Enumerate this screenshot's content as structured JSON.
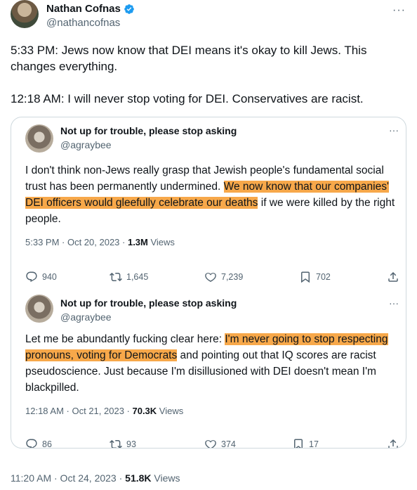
{
  "author": {
    "name": "Nathan Cofnas",
    "handle": "@nathancofnas"
  },
  "main_text": "5:33 PM: Jews now know that DEI means it's okay to kill Jews. This changes everything.\n\n12:18 AM: I will never stop voting for DEI. Conservatives are racist.",
  "quotes": [
    {
      "name": "Not up for trouble, please stop asking",
      "handle": "@agraybee",
      "text_before": "I don't think non-Jews really grasp that Jewish people's fundamental social trust has been permanently undermined. ",
      "text_highlight": "We now know that our companies' DEI officers would gleefully celebrate our deaths",
      "text_after": " if we were killed by the right people.",
      "time": "5:33 PM · Oct 20, 2023 · ",
      "views_count": "1.3M",
      "views_label": " Views",
      "replies": "940",
      "reposts": "1,645",
      "likes": "7,239",
      "bookmarks": "702"
    },
    {
      "name": "Not up for trouble, please stop asking",
      "handle": "@agraybee",
      "text_before": "Let me be abundantly fucking clear here: ",
      "text_highlight": "I'm never going to stop respecting pronouns, voting for Democrats",
      "text_after": " and pointing out that IQ scores are racist pseudoscience. Just because I'm disillusioned with DEI doesn't mean I'm blackpilled.",
      "time": "12:18 AM · Oct 21, 2023 · ",
      "views_count": "70.3K",
      "views_label": " Views",
      "replies": "86",
      "reposts": "93",
      "likes": "374",
      "bookmarks": "17"
    }
  ],
  "footer": {
    "time": "11:20 AM · Oct 24, 2023 · ",
    "views_count": "51.8K",
    "views_label": " Views"
  },
  "icons": {
    "more": "more-horizontal-icon",
    "verified": "verified-badge-icon",
    "reply": "reply-icon",
    "repost": "repost-icon",
    "like": "heart-icon",
    "bookmark": "bookmark-icon",
    "share": "share-icon"
  },
  "colors": {
    "highlight": "#f7a84a",
    "verified": "#1d9bf0",
    "secondary_text": "#536471",
    "border": "#cfd9de"
  }
}
